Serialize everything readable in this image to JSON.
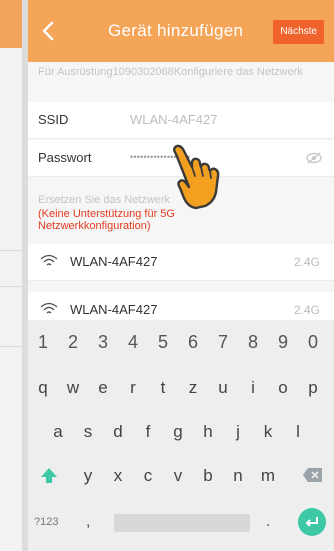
{
  "colors": {
    "header": "#f5a558",
    "next_button": "#f0632c",
    "warning": "#e23a1f",
    "enter_key": "#3dc9a5",
    "hand": "#f3a020"
  },
  "header": {
    "back_icon": "chevron-left-icon",
    "title": "Gerät hinzufügen",
    "next_label": "Nächste"
  },
  "hint": "Für Ausrüstung1090302068Konfiguriere das Netzwerk",
  "form": {
    "ssid_label": "SSID",
    "ssid_value": "WLAN-4AF427",
    "password_label": "Passwort",
    "password_value": "••••••••••••••••••",
    "visibility_icon": "eye-off-icon"
  },
  "networks": {
    "replace_label": "Ersetzen Sie das Netzwerk",
    "warning": "(Keine Unterstützung für 5G Netzwerkkonfiguration)",
    "items": [
      {
        "name": "WLAN-4AF427",
        "band": "2.4G",
        "icon": "wifi-icon"
      },
      {
        "name": "WLAN-4AF427",
        "band": "2.4G",
        "icon": "wifi-icon"
      }
    ]
  },
  "keyboard": {
    "row_numbers": [
      "1",
      "2",
      "3",
      "4",
      "5",
      "6",
      "7",
      "8",
      "9",
      "0"
    ],
    "row1": [
      "q",
      "w",
      "e",
      "r",
      "t",
      "z",
      "u",
      "i",
      "o",
      "p"
    ],
    "row2": [
      "a",
      "s",
      "d",
      "f",
      "g",
      "h",
      "j",
      "k",
      "l"
    ],
    "row3": [
      "y",
      "x",
      "c",
      "v",
      "b",
      "n",
      "m"
    ],
    "mode_label": "?123",
    "comma": ",",
    "period": "."
  }
}
